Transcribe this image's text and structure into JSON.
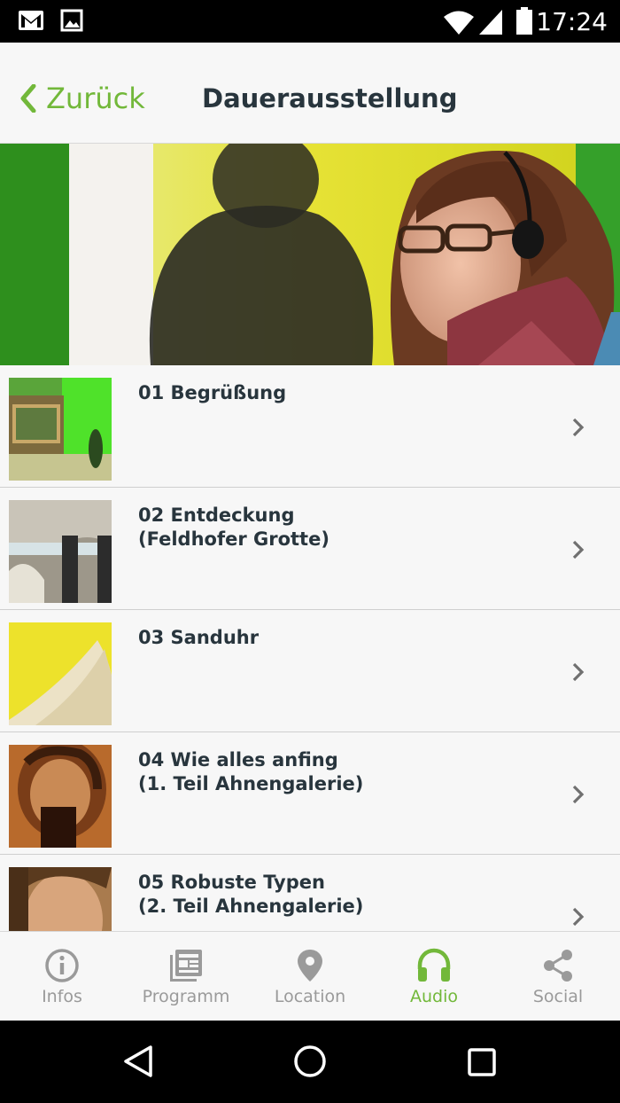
{
  "status_bar": {
    "time": "17:24",
    "icons": [
      "gmail-icon",
      "image-icon",
      "wifi-icon",
      "signal-icon",
      "battery-icon"
    ]
  },
  "header": {
    "back_label": "Zurück",
    "title": "Dauerausstellung"
  },
  "hero": {
    "image": "visitor-with-headphones-photo"
  },
  "tracks": [
    {
      "line1": "01 Begrüßung",
      "line2": ""
    },
    {
      "line1": "02 Entdeckung",
      "line2": "(Feldhofer Grotte)"
    },
    {
      "line1": "03 Sanduhr",
      "line2": ""
    },
    {
      "line1": "04 Wie alles anfing",
      "line2": "(1. Teil Ahnengalerie)"
    },
    {
      "line1": "05 Robuste Typen",
      "line2": "(2. Teil Ahnengalerie)"
    }
  ],
  "bottom_nav": {
    "items": [
      {
        "label": "Infos",
        "icon": "info-icon",
        "active": false
      },
      {
        "label": "Programm",
        "icon": "news-icon",
        "active": false
      },
      {
        "label": "Location",
        "icon": "location-pin-icon",
        "active": false
      },
      {
        "label": "Audio",
        "icon": "headphones-icon",
        "active": true
      },
      {
        "label": "Social",
        "icon": "share-icon",
        "active": false
      }
    ]
  },
  "colors": {
    "accent": "#72b83a",
    "title_text": "#28353d",
    "inactive_nav": "#9a9a9a",
    "background": "#f7f7f7"
  }
}
